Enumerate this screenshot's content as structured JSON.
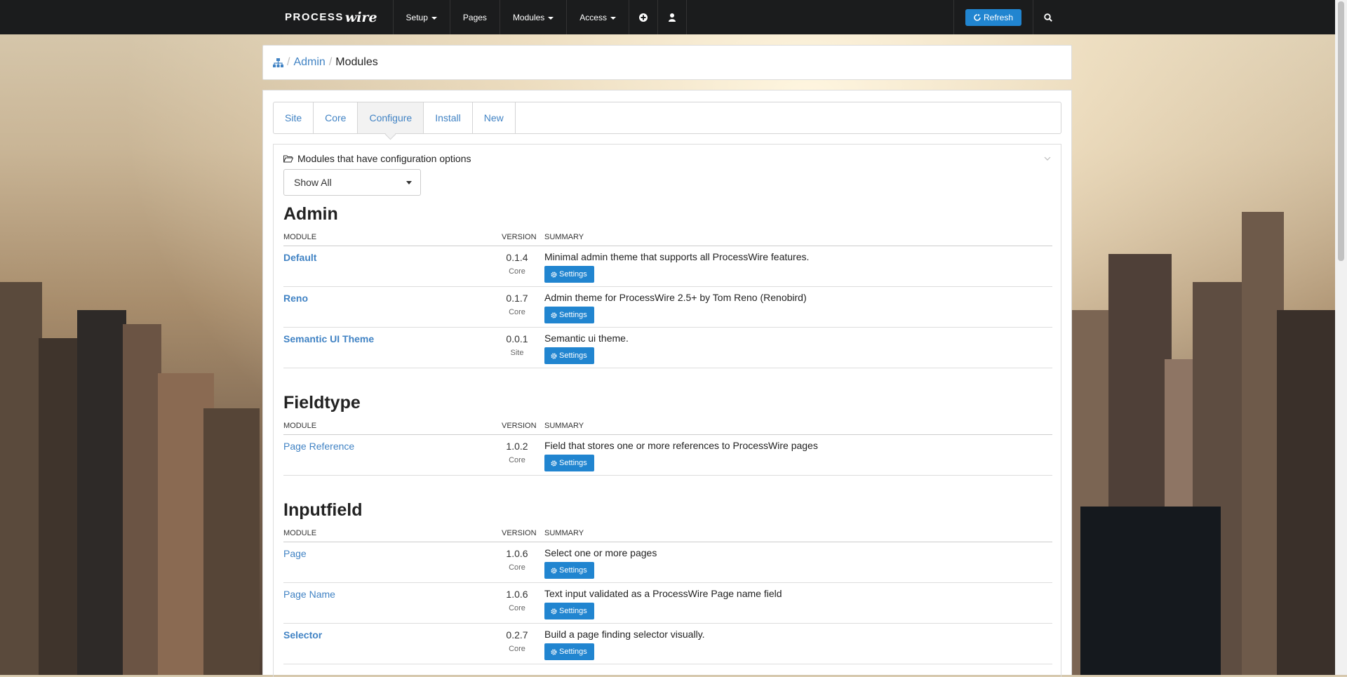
{
  "topbar": {
    "logo_main": "PROCESS",
    "logo_accent": "wire",
    "nav": [
      {
        "label": "Setup",
        "has_caret": true
      },
      {
        "label": "Pages",
        "has_caret": false
      },
      {
        "label": "Modules",
        "has_caret": true
      },
      {
        "label": "Access",
        "has_caret": true
      }
    ],
    "add_icon": "plus-circle-icon",
    "user_icon": "user-icon",
    "refresh_label": "Refresh",
    "refresh_icon": "refresh-icon",
    "search_icon": "search-icon"
  },
  "breadcrumb": {
    "home_icon": "sitemap-icon",
    "sep": "/",
    "admin": "Admin",
    "current": "Modules"
  },
  "tabs": [
    "Site",
    "Core",
    "Configure",
    "Install",
    "New"
  ],
  "active_tab": "Configure",
  "section": {
    "title": "Modules that have configuration options",
    "folder_icon": "folder-open-icon",
    "filter_value": "Show All"
  },
  "columns": {
    "module": "MODULE",
    "version": "VERSION",
    "summary": "SUMMARY"
  },
  "settings_label": "Settings",
  "groups": [
    {
      "title": "Admin",
      "rows": [
        {
          "name": "Default",
          "bold": true,
          "version": "0.1.4",
          "source": "Core",
          "summary": "Minimal admin theme that supports all ProcessWire features."
        },
        {
          "name": "Reno",
          "bold": true,
          "version": "0.1.7",
          "source": "Core",
          "summary": "Admin theme for ProcessWire 2.5+ by Tom Reno (Renobird)"
        },
        {
          "name": "Semantic UI Theme",
          "bold": true,
          "version": "0.0.1",
          "source": "Site",
          "summary": "Semantic ui theme."
        }
      ]
    },
    {
      "title": "Fieldtype",
      "rows": [
        {
          "name": "Page Reference",
          "bold": false,
          "version": "1.0.2",
          "source": "Core",
          "summary": "Field that stores one or more references to ProcessWire pages"
        }
      ]
    },
    {
      "title": "Inputfield",
      "rows": [
        {
          "name": "Page",
          "bold": false,
          "version": "1.0.6",
          "source": "Core",
          "summary": "Select one or more pages"
        },
        {
          "name": "Page Name",
          "bold": false,
          "version": "1.0.6",
          "source": "Core",
          "summary": "Text input validated as a ProcessWire Page name field"
        },
        {
          "name": "Selector",
          "bold": true,
          "version": "0.2.7",
          "source": "Core",
          "summary": "Build a page finding selector visually."
        }
      ]
    }
  ],
  "colors": {
    "accent": "#2185d0",
    "link": "#4183c4",
    "topbar": "#1b1c1d"
  }
}
